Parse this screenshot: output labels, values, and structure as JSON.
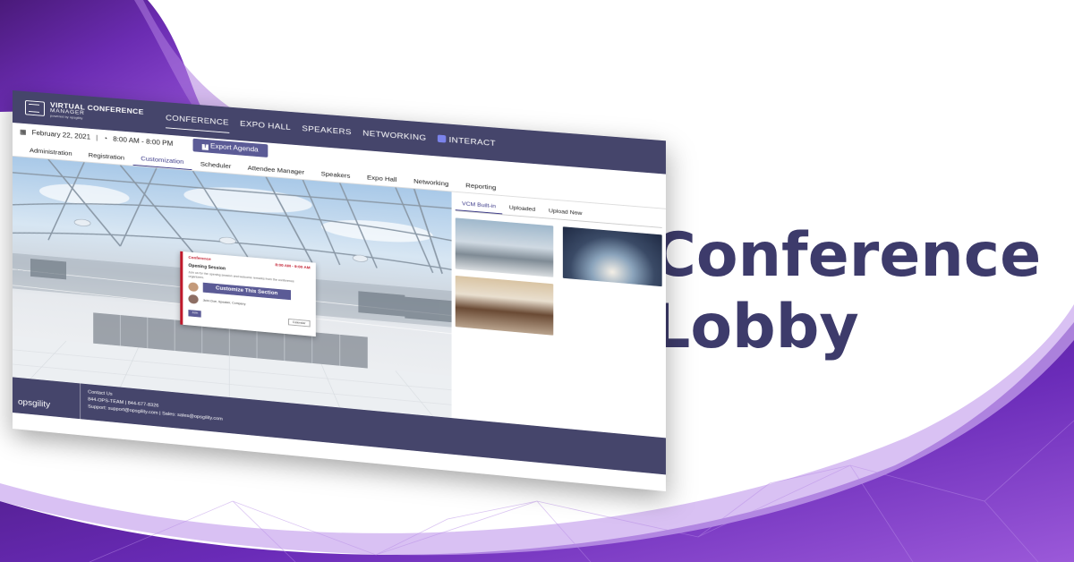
{
  "colors": {
    "brand_navy": "#45456b",
    "headline": "#3d3b6b",
    "purple": "#6a2bb8",
    "accent_red": "#c0192b"
  },
  "headline": {
    "line1": "Conference",
    "line2": "Lobby"
  },
  "app": {
    "brand": {
      "title": "VIRTUAL CONFERENCE",
      "subtitle": "MANAGER",
      "by": "powered by opsgility"
    },
    "nav": [
      "CONFERENCE",
      "EXPO HALL",
      "SPEAKERS",
      "NETWORKING",
      "INTERACT"
    ],
    "date": "February 22, 2021",
    "time": "8:00 AM - 8:00 PM",
    "export_label": "Export Agenda",
    "subnav": [
      "Administration",
      "Registration",
      "Customization",
      "Scheduler",
      "Attendee Manager",
      "Speakers",
      "Expo Hall",
      "Networking",
      "Reporting"
    ],
    "modal": {
      "label": "Conference",
      "time": "8:00 AM - 9:00 AM",
      "title": "Opening Session",
      "description": "Join us for the opening session and welcome remarks from the conference organizers.",
      "button": "Customize This Section",
      "speaker": "John Doe, Speaker, Company",
      "join": "Join",
      "calendar": "Calendar"
    },
    "gallery": {
      "tabs": [
        "VCM Built-in",
        "Uploaded",
        "Upload New"
      ],
      "thumbs": [
        "lobby-hall",
        "hangar",
        "cafeteria"
      ]
    },
    "footer": {
      "logo": "opsgility",
      "contact_title": "Contact Us",
      "phone": "844-OPS-TEAM | 844-677-8326",
      "support": "Support: support@opsgility.com | Sales: sales@opsgility.com"
    }
  }
}
